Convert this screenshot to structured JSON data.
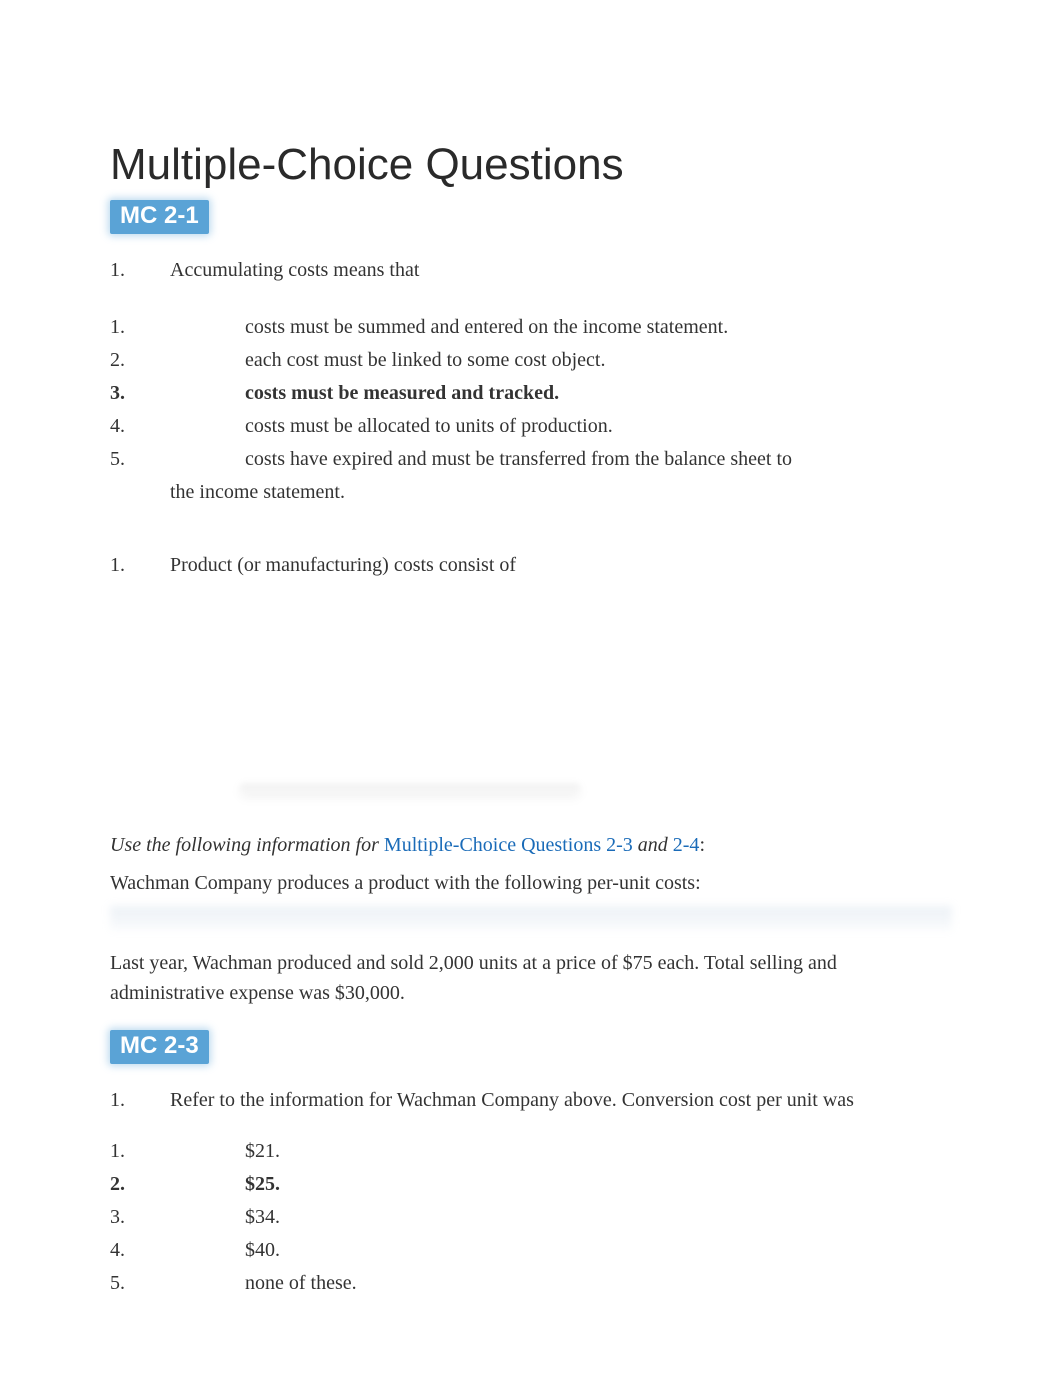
{
  "main_title": "Multiple-Choice Questions",
  "mc21": {
    "badge": "MC 2-1",
    "q_num": "1.",
    "q_text": "Accumulating costs means that",
    "options": [
      {
        "num": "1.",
        "text": "costs must be summed and entered on the income statement.",
        "bold": false
      },
      {
        "num": "2.",
        "text": "each cost must be linked to some cost object.",
        "bold": false
      },
      {
        "num": "3.",
        "text": "costs must be measured and tracked.",
        "bold": true
      },
      {
        "num": "4.",
        "text": "costs must be allocated to units of production.",
        "bold": false
      },
      {
        "num": "5.",
        "text": "costs have expired and must be transferred from the balance sheet to the income statement.",
        "bold": false
      }
    ]
  },
  "q2": {
    "q_num": "1.",
    "q_text": "Product (or manufacturing) costs consist of"
  },
  "shared_info": {
    "prefix": "Use the following information for ",
    "link1": "Multiple-Choice Questions 2-3",
    "mid": " and ",
    "link2": "2-4",
    "suffix": ":",
    "body": "Wachman Company produces a product with the following per-unit costs:",
    "body2": "Last year, Wachman produced and sold 2,000 units at a price of $75 each. Total selling and administrative expense was $30,000."
  },
  "mc23": {
    "badge": "MC 2-3",
    "q_num": "1.",
    "q_text": "Refer to the information for Wachman Company above. Conversion cost per unit was",
    "options": [
      {
        "num": "1.",
        "text": "$21.",
        "bold": false
      },
      {
        "num": "2.",
        "text": "$25.",
        "bold": true
      },
      {
        "num": "3.",
        "text": "$34.",
        "bold": false
      },
      {
        "num": "4.",
        "text": "$40.",
        "bold": false
      },
      {
        "num": "5.",
        "text": "none of these.",
        "bold": false
      }
    ]
  }
}
